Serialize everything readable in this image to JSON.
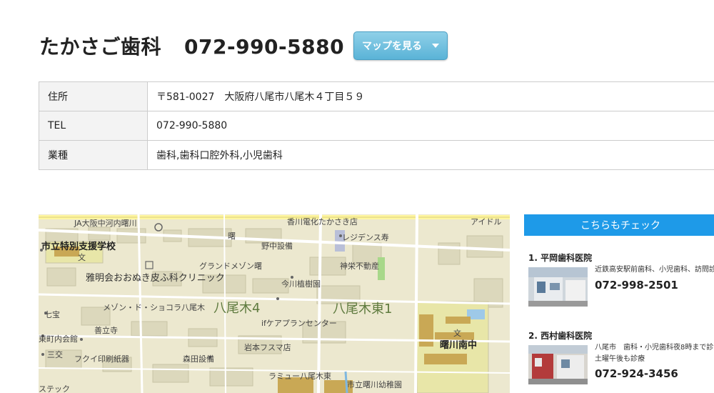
{
  "header": {
    "clinic_name": "たかさご歯科",
    "phone": "072-990-5880",
    "map_button_label": "マップを見る"
  },
  "info": {
    "rows": [
      {
        "key": "住所",
        "value": "〒581-0027　大阪府八尾市八尾木４丁目５９"
      },
      {
        "key": "TEL",
        "value": "072-990-5880"
      },
      {
        "key": "業種",
        "value": "歯科,歯科口腔外科,小児歯科"
      }
    ]
  },
  "map": {
    "labels": {
      "ja": "JA大阪中河内曙川",
      "kagawa": "香川電化たかさき店",
      "aidoru": "アイドル",
      "school": "市立特別支援学校",
      "residence": "レジデンス寿",
      "nonaka": "野中設備",
      "akebono": "曙",
      "grand": "グランドメゾン曙",
      "shin": "神栄不動産",
      "clinic": "雅明会おおぬき皮ふ科クリニック",
      "imagawa": "今川植樹園",
      "area1": "八尾木4",
      "area2": "八尾木東1",
      "chocolat": "メゾン・ド・ショコラ八尾木",
      "shichiho": "七宝",
      "zenryu": "善立寺",
      "ifcare": "ifケアプランセンター",
      "kominkan": "東町内会館",
      "fukui": "フクイ印刷紙器",
      "iwamoto": "岩本フスマ店",
      "morita": "森田設備",
      "sanko": "三交",
      "lamu": "ラミュー八尾木東",
      "kindergarten": "市立曙川幼稚園",
      "junior": "曙川南中",
      "bun": "文",
      "stick": "ステック"
    }
  },
  "sidebar": {
    "heading": "こちらもチェック",
    "items": [
      {
        "name": "1. 平岡歯科医院",
        "desc1": "近鉄高安駅前歯科、小児歯科、訪問診",
        "desc2": "",
        "tel": "072-998-2501"
      },
      {
        "name": "2. 西村歯科医院",
        "desc1": "八尾市　歯科・小児歯科夜8時まで診",
        "desc2": "土曜午後も診療",
        "tel": "072-924-3456"
      }
    ]
  }
}
